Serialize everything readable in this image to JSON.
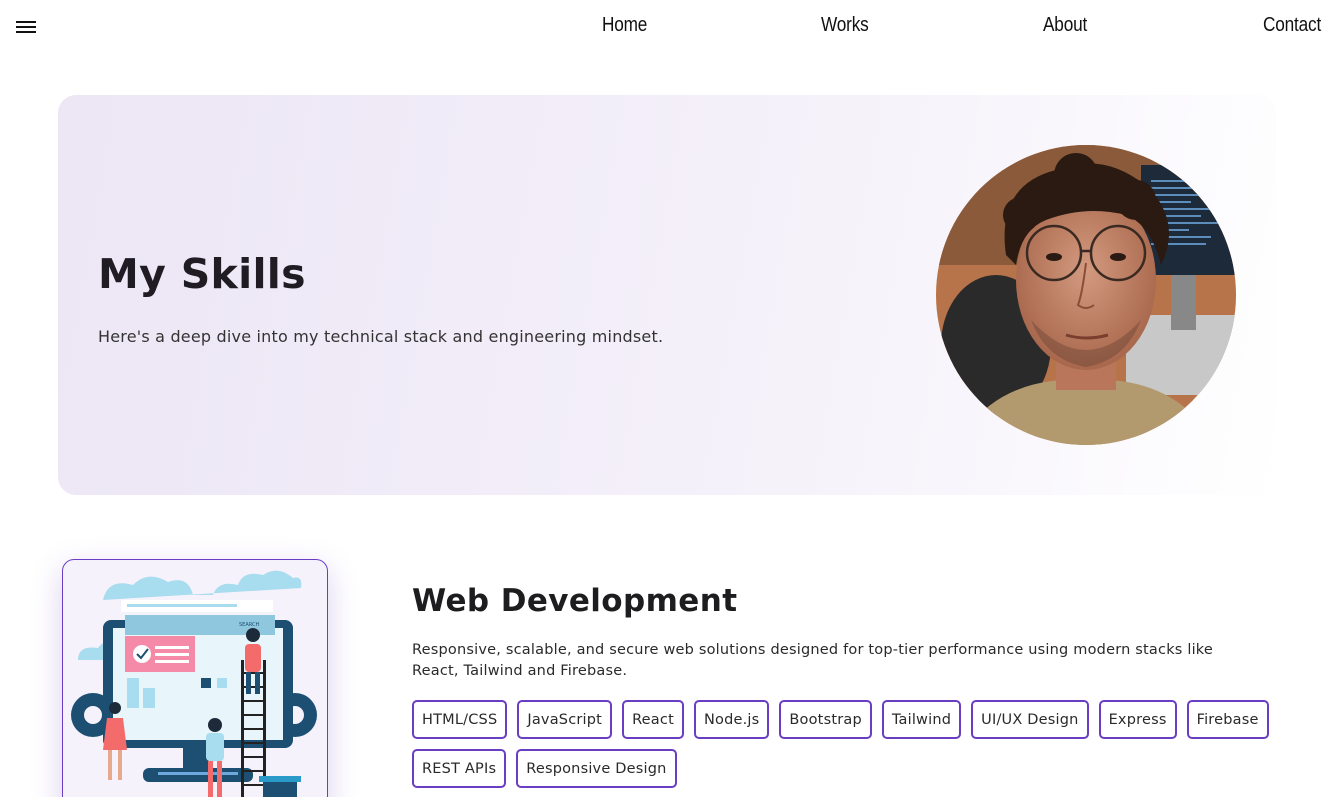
{
  "nav": {
    "menu_icon": "hamburger-menu-icon",
    "links": [
      "Home",
      "Works",
      "About",
      "Contact"
    ]
  },
  "hero": {
    "title": "My Skills",
    "subtitle": "Here's a deep dive into my technical stack and engineering mindset."
  },
  "web_dev": {
    "title": "Web Development",
    "description": "Responsive, scalable, and secure web solutions designed for top-tier performance using modern stacks like React, Tailwind and Firebase.",
    "illustration_search_label": "SEARCH",
    "tags": [
      "HTML/CSS",
      "JavaScript",
      "React",
      "Node.js",
      "Bootstrap",
      "Tailwind",
      "UI/UX Design",
      "Express",
      "Firebase",
      "REST APIs",
      "Responsive Design"
    ]
  },
  "colors": {
    "accent": "#6a3ec2",
    "hero_bg": "#ece6f5",
    "text": "#1d1d1f"
  }
}
